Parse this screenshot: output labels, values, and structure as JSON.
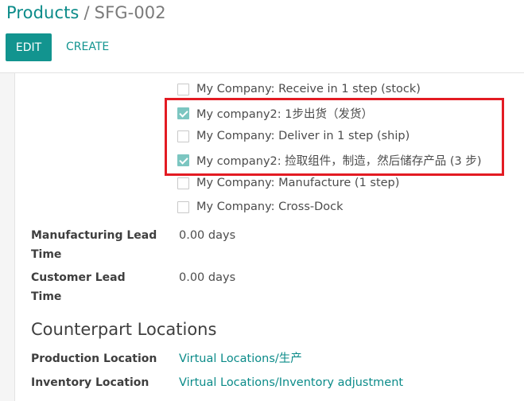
{
  "breadcrumb": {
    "parent": "Products",
    "separator": "/",
    "current": "SFG-002"
  },
  "toolbar": {
    "edit_label": "EDIT",
    "create_label": "CREATE"
  },
  "routes": [
    {
      "label": "My Company: Receive in 1 step (stock)",
      "checked": false
    },
    {
      "label": "My company2: 1步出货（发货）",
      "checked": true
    },
    {
      "label": "My Company: Deliver in 1 step (ship)",
      "checked": false
    },
    {
      "label": "My company2: 捡取组件，制造，然后储存产品 (3 步)",
      "checked": true
    },
    {
      "label": "My Company: Manufacture (1 step)",
      "checked": false
    },
    {
      "label": "My Company: Cross-Dock",
      "checked": false
    }
  ],
  "fields": {
    "manufacturing_lead_time": {
      "label": "Manufacturing Lead Time",
      "value": "0.00 days"
    },
    "customer_lead_time": {
      "label": "Customer Lead Time",
      "value": "0.00 days"
    }
  },
  "counterpart": {
    "title": "Counterpart Locations",
    "production_location": {
      "label": "Production Location",
      "value": "Virtual Locations/生产"
    },
    "inventory_location": {
      "label": "Inventory Location",
      "value": "Virtual Locations/Inventory adjustment"
    }
  },
  "colors": {
    "accent": "#12948f",
    "link": "#0b8b89",
    "highlight_border": "#e31b23",
    "checkbox_checked": "#7cc6c1"
  }
}
